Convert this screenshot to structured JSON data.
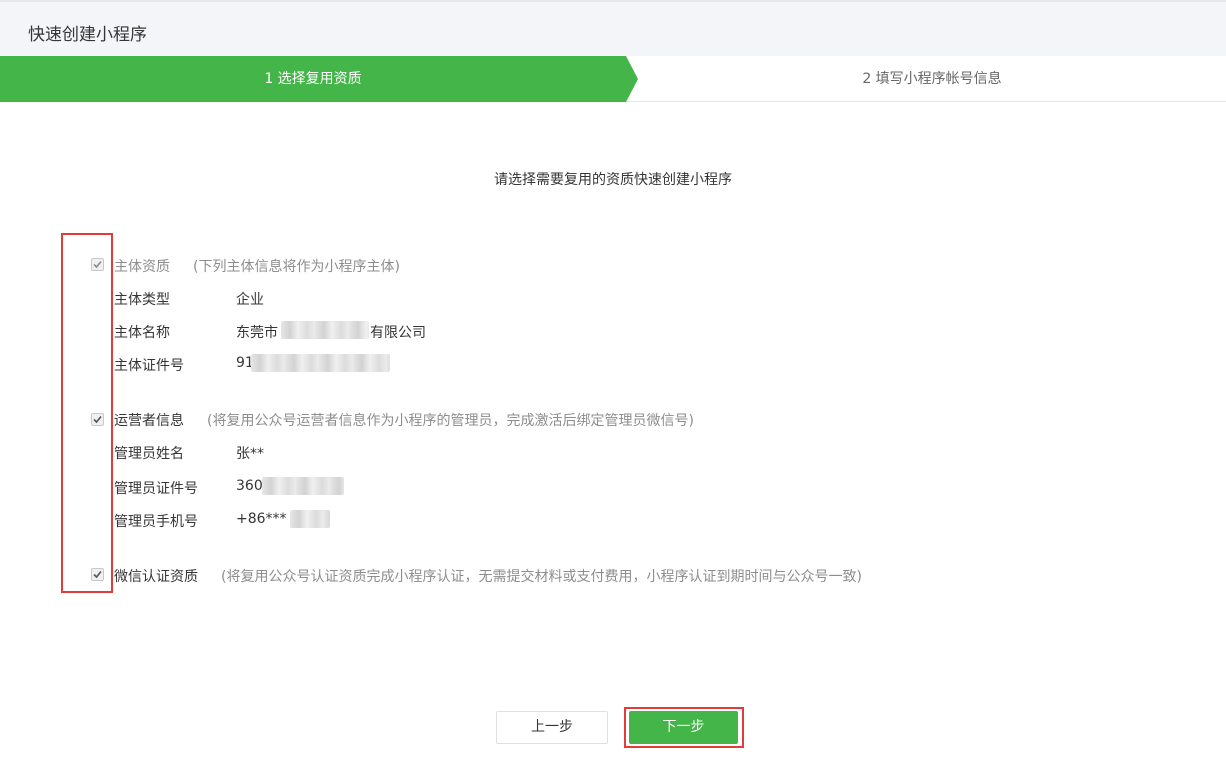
{
  "header": {
    "title": "快速创建小程序"
  },
  "steps": [
    {
      "label": "1 选择复用资质"
    },
    {
      "label": "2 填写小程序帐号信息"
    }
  ],
  "subtitle": "请选择需要复用的资质快速创建小程序",
  "sections": {
    "entity": {
      "title": "主体资质",
      "hint": "(下列主体信息将作为小程序主体)",
      "checked": true,
      "rows": [
        {
          "label": "主体类型",
          "value": "企业"
        },
        {
          "label": "主体名称",
          "value": "东莞市",
          "value_suffix": "有限公司"
        },
        {
          "label": "主体证件号",
          "value": "91"
        }
      ]
    },
    "operator": {
      "title": "运营者信息",
      "hint": "(将复用公众号运营者信息作为小程序的管理员，完成激活后绑定管理员微信号)",
      "checked": true,
      "rows": [
        {
          "label": "管理员姓名",
          "value": "张**"
        },
        {
          "label": "管理员证件号",
          "value": "360"
        },
        {
          "label": "管理员手机号",
          "value": "+86***"
        }
      ]
    },
    "wechat_cert": {
      "title": "微信认证资质",
      "hint": "(将复用公众号认证资质完成小程序认证，无需提交材料或支付费用，小程序认证到期时间与公众号一致)",
      "checked": true
    }
  },
  "buttons": {
    "prev": "上一步",
    "next": "下一步"
  },
  "colors": {
    "accent": "#44b549",
    "highlight": "#e33a3a",
    "hint_text": "#8d8d8d"
  }
}
